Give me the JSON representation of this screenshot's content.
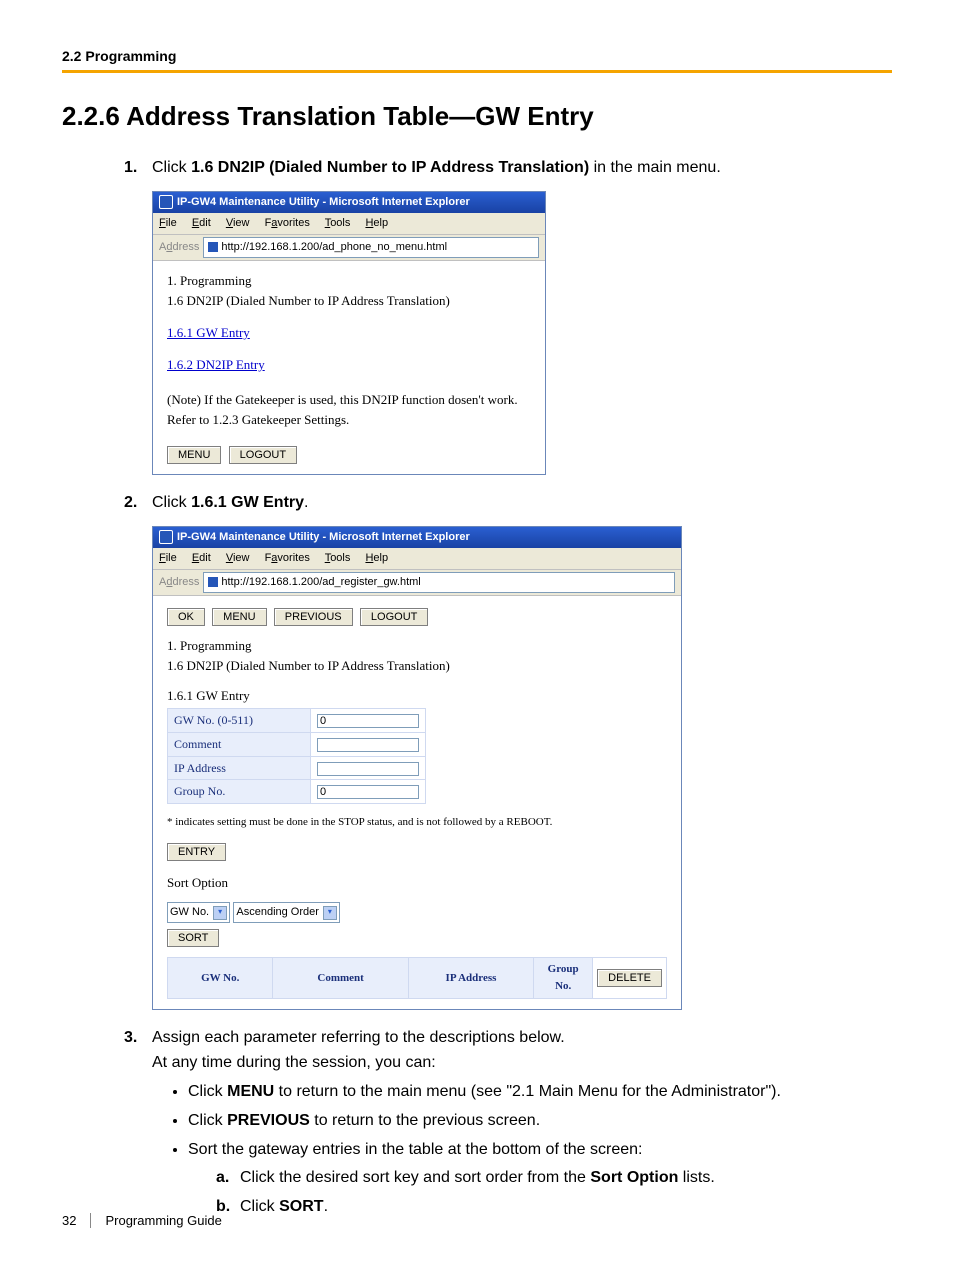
{
  "header": {
    "section_path": "2.2 Programming"
  },
  "title": "2.2.6   Address Translation Table—GW Entry",
  "steps": {
    "s1": {
      "pre": "Click ",
      "bold": "1.6 DN2IP (Dialed Number to IP Address Translation)",
      "post": " in the main menu."
    },
    "s2": {
      "pre": "Click ",
      "bold": "1.6.1 GW Entry",
      "post": "."
    },
    "s3": {
      "line1": "Assign each parameter referring to the descriptions below.",
      "line2": "At any time during the session, you can:",
      "b1_pre": "Click ",
      "b1_bold": "MENU",
      "b1_post": " to return to the main menu (see \"2.1 Main Menu for the Administrator\").",
      "b2_pre": "Click ",
      "b2_bold": "PREVIOUS",
      "b2_post": " to return to the previous screen.",
      "b3": "Sort the gateway entries in the table at the bottom of the screen:",
      "a_pre": "Click the desired sort key and sort order from the ",
      "a_bold": "Sort Option",
      "a_post": " lists.",
      "bb_pre": "Click ",
      "bb_bold": "SORT",
      "bb_post": "."
    }
  },
  "ie": {
    "title": "IP-GW4 Maintenance Utility - Microsoft Internet Explorer",
    "menu": {
      "file": "File",
      "edit": "Edit",
      "view": "View",
      "favorites": "Favorites",
      "tools": "Tools",
      "help": "Help"
    },
    "address_label": "Address",
    "url1": "http://192.168.1.200/ad_phone_no_menu.html",
    "url2": "http://192.168.1.200/ad_register_gw.html"
  },
  "shot1": {
    "line1": "1. Programming",
    "line2": "1.6 DN2IP (Dialed Number to IP Address Translation)",
    "link1": "1.6.1 GW Entry",
    "link2": "1.6.2 DN2IP Entry",
    "note1": "(Note) If the Gatekeeper is used, this DN2IP function dosen't work.",
    "note2": "Refer to 1.2.3 Gatekeeper Settings.",
    "btn_menu": "MENU",
    "btn_logout": "LOGOUT"
  },
  "shot2": {
    "btn_ok": "OK",
    "btn_menu": "MENU",
    "btn_previous": "PREVIOUS",
    "btn_logout": "LOGOUT",
    "line1": "1. Programming",
    "line2": "1.6 DN2IP (Dialed Number to IP Address Translation)",
    "subtitle": "1.6.1 GW Entry",
    "fields": {
      "gwno_label": "GW No. (0-511)",
      "gwno_value": "0",
      "comment_label": "Comment",
      "comment_value": "",
      "ip_label": "IP Address",
      "ip_value": "",
      "group_label": "Group No.",
      "group_value": "0"
    },
    "footnote": "* indicates setting must be done in the STOP status, and is not followed by a REBOOT.",
    "btn_entry": "ENTRY",
    "sort_option_label": "Sort Option",
    "sort_key": "GW No.",
    "sort_order": "Ascending Order",
    "btn_sort": "SORT",
    "grid": {
      "h_gwno": "GW No.",
      "h_comment": "Comment",
      "h_ip": "IP Address",
      "h_group": "Group No.",
      "btn_delete": "DELETE"
    }
  },
  "footer": {
    "page_number": "32",
    "doc_title": "Programming Guide"
  }
}
